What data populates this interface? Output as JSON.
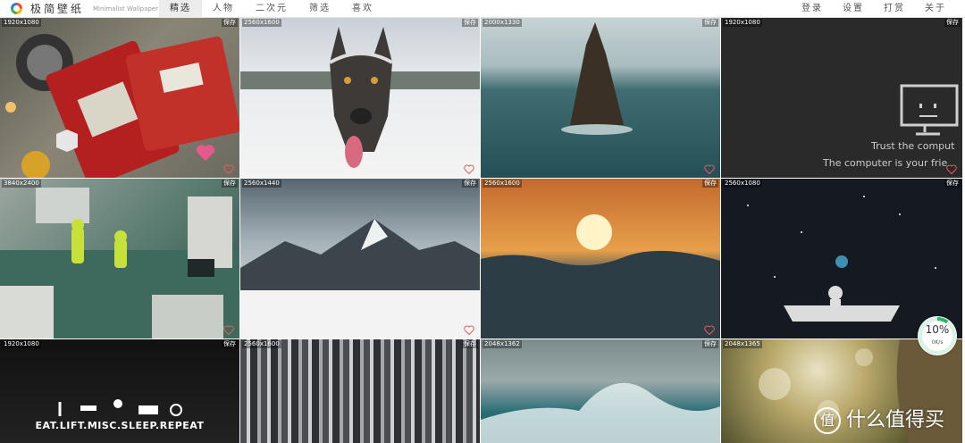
{
  "header": {
    "brand": "极简壁纸",
    "brand_en": "Minimalist Wallpaper",
    "nav": [
      {
        "label": "精选",
        "active": true
      },
      {
        "label": "人物"
      },
      {
        "label": "二次元"
      },
      {
        "label": "筛选"
      },
      {
        "label": "喜欢"
      }
    ],
    "right_nav": [
      "登录",
      "设置",
      "打赏",
      "关于"
    ]
  },
  "tiles": [
    {
      "res": "1920x1080",
      "save": "保存",
      "theme": "red-console"
    },
    {
      "res": "2560x1600",
      "save": "保存",
      "theme": "wolf-snow"
    },
    {
      "res": "2000x1330",
      "save": "保存",
      "theme": "sea-rock"
    },
    {
      "res": "1920x1080",
      "save": "保存",
      "theme": "computer-face",
      "line1": "Trust the comput",
      "line2": "The computer is your frie"
    },
    {
      "res": "3840x2400",
      "save": "保存",
      "theme": "circuit"
    },
    {
      "res": "2560x1440",
      "save": "保存",
      "theme": "mountains"
    },
    {
      "res": "2560x1600",
      "save": "保存",
      "theme": "sunset"
    },
    {
      "res": "2560x1080",
      "save": "保存",
      "theme": "moon-space"
    },
    {
      "res": "1920x1080",
      "save": "保存",
      "theme": "eat-lift",
      "text": "EAT.LIFT.MISC.SLEEP.REPEAT"
    },
    {
      "res": "2560x1600",
      "save": "保存",
      "theme": "city-aerial"
    },
    {
      "res": "2048x1362",
      "save": "保存",
      "theme": "wave"
    },
    {
      "res": "2048x1365",
      "save": "保存",
      "theme": "forest-bokeh"
    }
  ],
  "download": {
    "percent": "10%",
    "rate": "0K/s"
  },
  "watermark": "什么值得买",
  "watermark_glyph": "值",
  "colors": {
    "heart": "#e85a5a",
    "nav_active_bg": "#ececec"
  }
}
